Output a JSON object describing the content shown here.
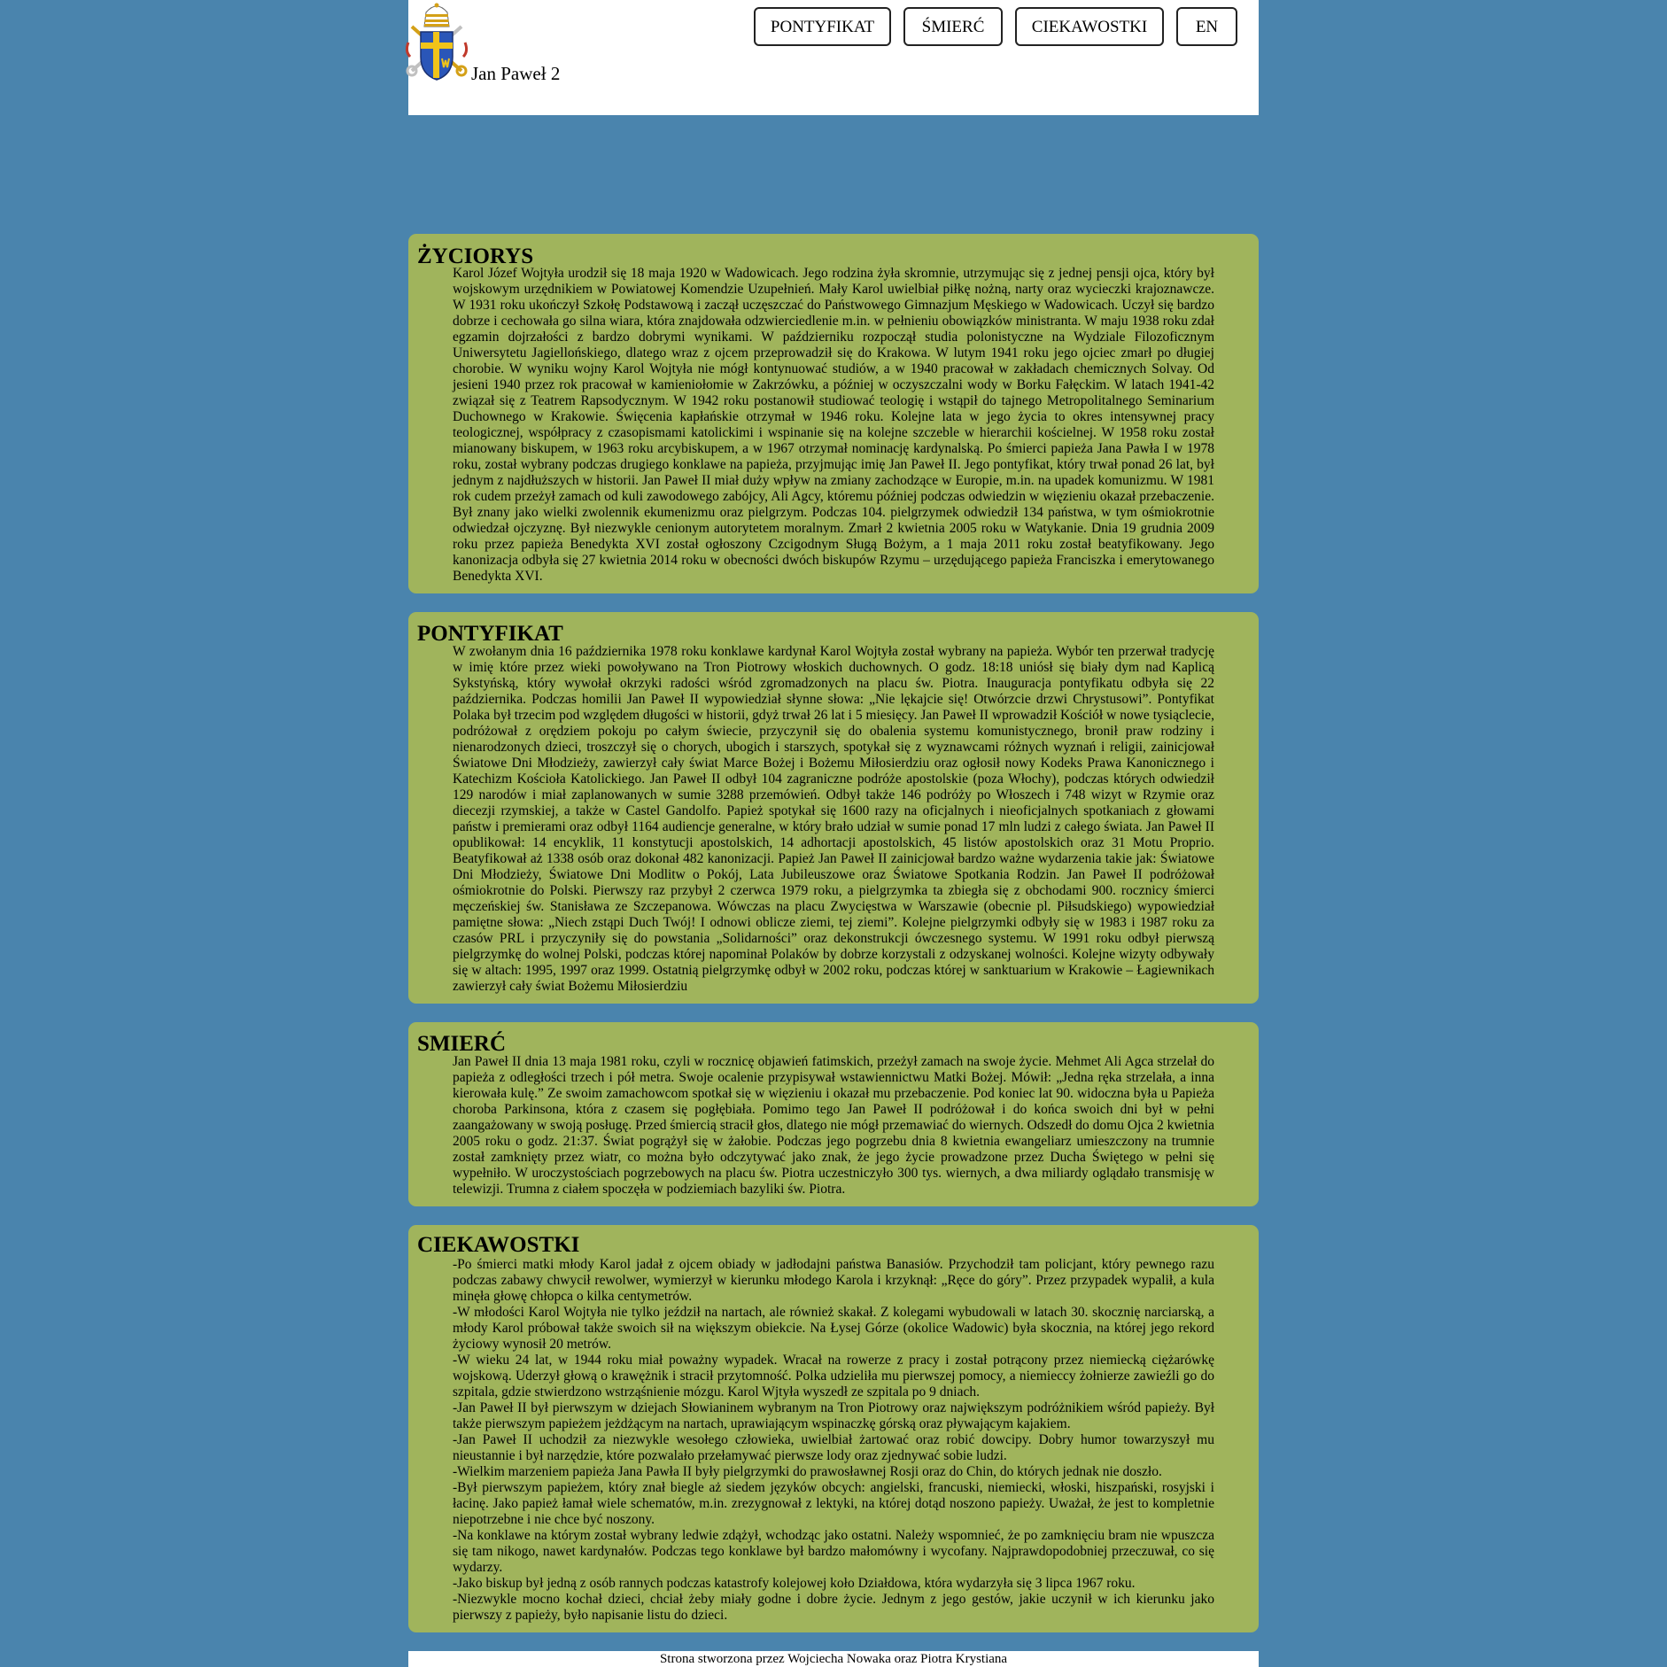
{
  "site": {
    "title": "Jan Paweł 2",
    "logo_icon": "papal-coat-of-arms-icon"
  },
  "nav": {
    "items": [
      "PONTYFIKAT",
      "ŚMIERĆ",
      "CIEKAWOSTKI",
      "EN"
    ]
  },
  "colors": {
    "background": "#4a84ad",
    "section": "#a0b45c",
    "header": "#ffffff"
  },
  "sections": [
    {
      "heading": "ŻYCIORYS",
      "paragraphs": [
        "Karol Józef Wojtyła urodził się 18 maja 1920 w Wadowicach. Jego rodzina żyła skromnie, utrzymując się z jednej pensji ojca, który był wojskowym urzędnikiem w Powiatowej Komendzie Uzupełnień. Mały Karol uwielbiał piłkę nożną, narty oraz wycieczki krajoznawcze. W 1931 roku ukończył Szkołę Podstawową i zaczął uczęszczać do Państwowego Gimnazjum Męskiego w Wadowicach. Uczył się bardzo dobrze i cechowała go silna wiara, która znajdowała odzwierciedlenie m.in. w pełnieniu obowiązków ministranta. W maju 1938 roku zdał egzamin dojrzałości z bardzo dobrymi wynikami. W październiku rozpoczął studia polonistyczne na Wydziale Filozoficznym Uniwersytetu Jagiellońskiego, dlatego wraz z ojcem przeprowadził się do Krakowa. W lutym 1941 roku jego ojciec zmarł po długiej chorobie. W wyniku wojny Karol Wojtyła nie mógł kontynuować studiów, a w 1940 pracował w zakładach chemicznych Solvay. Od jesieni 1940 przez rok pracował w kamieniołomie w Zakrzówku, a później w oczyszczalni wody w Borku Fałęckim. W latach 1941-42 związał się z Teatrem Rapsodycznym. W 1942 roku postanowił studiować teologię i wstąpił do tajnego Metropolitalnego Seminarium Duchownego w Krakowie. Święcenia kapłańskie otrzymał w 1946 roku. Kolejne lata w jego życia to okres intensywnej pracy teologicznej, współpracy z czasopismami katolickimi i wspinanie się na kolejne szczeble w hierarchii kościelnej. W 1958 roku został mianowany biskupem, w 1963 roku arcybiskupem, a w 1967 otrzymał nominację kardynalską. Po śmierci papieża Jana Pawła I w 1978 roku, został wybrany podczas drugiego konklawe na papieża, przyjmując imię Jan Paweł II. Jego pontyfikat, który trwał ponad 26 lat, był jednym z najdłuższych w historii. Jan Paweł II miał duży wpływ na zmiany zachodzące w Europie, m.in. na upadek komunizmu. W 1981 rok cudem przeżył zamach od kuli zawodowego zabójcy, Ali Agcy, któremu później podczas odwiedzin w więzieniu okazał przebaczenie. Był znany jako wielki zwolennik ekumenizmu oraz pielgrzym. Podczas 104. pielgrzymek odwiedził 134 państwa, w tym ośmiokrotnie odwiedzał ojczyznę. Był niezwykle cenionym autorytetem moralnym. Zmarł 2 kwietnia 2005 roku w Watykanie. Dnia 19 grudnia 2009 roku przez papieża Benedykta XVI został ogłoszony Czcigodnym Sługą Bożym, a 1 maja 2011 roku został beatyfikowany. Jego kanonizacja odbyła się 27 kwietnia 2014 roku w obecności dwóch biskupów Rzymu – urzędującego papieża Franciszka i emerytowanego Benedykta XVI."
      ]
    },
    {
      "heading": "PONTYFIKAT",
      "paragraphs": [
        "W zwołanym dnia 16 października 1978 roku konklawe kardynał Karol Wojtyła został wybrany na papieża. Wybór ten przerwał tradycję w imię które przez wieki powoływano na Tron Piotrowy włoskich duchownych. O godz. 18:18 uniósł się biały dym nad Kaplicą Sykstyńską, który wywołał okrzyki radości wśród zgromadzonych na placu św. Piotra. Inauguracja pontyfikatu odbyła się 22 października. Podczas homilii Jan Paweł II wypowiedział słynne słowa: „Nie lękajcie się! Otwórzcie drzwi Chrystusowi”. Pontyfikat Polaka był trzecim pod względem długości w historii, gdyż trwał 26 lat i 5 miesięcy. Jan Paweł II wprowadził Kościół w nowe tysiąclecie, podróżował z orędziem pokoju po całym świecie, przyczynił się do obalenia systemu komunistycznego, bronił praw rodziny i nienarodzonych dzieci, troszczył się o chorych, ubogich i starszych, spotykał się z wyznawcami różnych wyznań i religii, zainicjował Światowe Dni Młodzieży, zawierzył cały świat Marce Bożej i Bożemu Miłosierdziu oraz ogłosił nowy Kodeks Prawa Kanonicznego i Katechizm Kościoła Katolickiego. Jan Paweł II odbył 104 zagraniczne podróże apostolskie (poza Włochy), podczas których odwiedził 129 narodów i miał zaplanowanych w sumie 3288 przemówień. Odbył także 146 podróży po Włoszech i 748 wizyt w Rzymie oraz diecezji rzymskiej, a także w Castel Gandolfo. Papież spotykał się 1600 razy na oficjalnych i nieoficjalnych spotkaniach z głowami państw i premierami oraz odbył 1164 audiencje generalne, w który brało udział w sumie ponad 17 mln ludzi z całego świata. Jan Paweł II opublikował: 14 encyklik, 11 konstytucji apostolskich, 14 adhortacji apostolskich, 45 listów apostolskich oraz 31 Motu Proprio. Beatyfikował aż 1338 osób oraz dokonał 482 kanonizacji. Papież Jan Paweł II zainicjował bardzo ważne wydarzenia takie jak: Światowe Dni Młodzieży, Światowe Dni Modlitw o Pokój, Lata Jubileuszowe oraz Światowe Spotkania Rodzin. Jan Paweł II podróżował ośmiokrotnie do Polski. Pierwszy raz przybył 2 czerwca 1979 roku, a pielgrzymka ta zbiegła się z obchodami 900. rocznicy śmierci męczeńskiej św. Stanisława ze Szczepanowa. Wówczas na placu Zwycięstwa w Warszawie (obecnie pl. Piłsudskiego) wypowiedział pamiętne słowa: „Niech zstąpi Duch Twój! I odnowi oblicze ziemi, tej ziemi”. Kolejne pielgrzymki odbyły się w 1983 i 1987 roku za czasów PRL i przyczyniły się do powstania „Solidarności” oraz dekonstrukcji ówczesnego systemu. W 1991 roku odbył pierwszą pielgrzymkę do wolnej Polski, podczas której napominał Polaków by dobrze korzystali z odzyskanej wolności. Kolejne wizyty odbywały się w altach: 1995, 1997 oraz 1999. Ostatnią pielgrzymkę odbył w 2002 roku, podczas której w sanktuarium w Krakowie – Łagiewnikach zawierzył cały świat Bożemu Miłosierdziu"
      ]
    },
    {
      "heading": "SMIERĆ",
      "paragraphs": [
        "Jan Paweł II dnia 13 maja 1981 roku, czyli w rocznicę objawień fatimskich, przeżył zamach na swoje życie. Mehmet Ali Agca strzelał do papieża z odległości trzech i pół metra. Swoje ocalenie przypisywał wstawiennictwu Matki Bożej. Mówił: „Jedna ręka strzelała, a inna kierowała kulę.” Ze swoim zamachowcom spotkał się w więzieniu i okazał mu przebaczenie. Pod koniec lat 90. widoczna była u Papieża choroba Parkinsona, która z czasem się pogłębiała. Pomimo tego Jan Paweł II podróżował i do końca swoich dni był w pełni zaangażowany w swoją posługę. Przed śmiercią stracił głos, dlatego nie mógł przemawiać do wiernych. Odszedł do domu Ojca 2 kwietnia 2005 roku o godz. 21:37. Świat pogrążył się w żałobie. Podczas jego pogrzebu dnia 8 kwietnia ewangeliarz umieszczony na trumnie został zamknięty przez wiatr, co można było odczytywać jako znak, że jego życie prowadzone przez Ducha Świętego w pełni się wypełniło. W uroczystościach pogrzebowych na placu św. Piotra uczestniczyło 300 tys. wiernych, a dwa miliardy oglądało transmisję w telewizji. Trumna z ciałem spoczęła w podziemiach bazyliki św. Piotra."
      ]
    },
    {
      "heading": "CIEKAWOSTKI",
      "paragraphs": [
        "-Po śmierci matki młody Karol jadał z ojcem obiady w jadłodajni państwa Banasiów. Przychodził tam policjant, który pewnego razu podczas zabawy chwycił rewolwer, wymierzył w kierunku młodego Karola i krzyknął: „Ręce do góry”. Przez przypadek wypalił, a kula minęła głowę chłopca o kilka centymetrów.",
        "-W młodości Karol Wojtyła nie tylko jeździł na nartach, ale również skakał. Z kolegami wybudowali w latach 30. skocznię narciarską, a młody Karol próbował także swoich sił na większym obiekcie. Na Łysej Górze (okolice Wadowic) była skocznia, na której jego rekord życiowy wynosił 20 metrów.",
        "-W wieku 24 lat, w 1944 roku miał poważny wypadek. Wracał na rowerze z pracy i został potrącony przez niemiecką ciężarówkę wojskową. Uderzył głową o krawężnik i stracił przytomność. Polka udzieliła mu pierwszej pomocy, a niemieccy żołnierze zawieźli go do szpitala, gdzie stwierdzono wstrząśnienie mózgu. Karol Wjtyła wyszedł ze szpitala po 9 dniach.",
        "-Jan Paweł II był pierwszym w dziejach Słowianinem wybranym na Tron Piotrowy oraz największym podróżnikiem wśród papieży. Był także pierwszym papieżem jeżdżącym na nartach, uprawiającym wspinaczkę górską oraz pływającym kajakiem.",
        "-Jan Paweł II uchodził za niezwykle wesołego człowieka, uwielbiał żartować oraz robić dowcipy. Dobry humor towarzyszył mu nieustannie i był narzędzie, które pozwalało przełamywać pierwsze lody oraz zjednywać sobie ludzi.",
        "-Wielkim marzeniem papieża Jana Pawła II były pielgrzymki do prawosławnej Rosji oraz do Chin, do których jednak nie doszło.",
        "-Był pierwszym papieżem, który znał biegle aż siedem języków obcych: angielski, francuski, niemiecki, włoski, hiszpański, rosyjski i łacinę. Jako papież łamał wiele schematów, m.in. zrezygnował z lektyki, na której dotąd noszono papieży. Uważał, że jest to kompletnie niepotrzebne i nie chce być noszony.",
        "-Na konklawe na którym został wybrany ledwie zdążył, wchodząc jako ostatni. Należy wspomnieć, że po zamknięciu bram nie wpuszcza się tam nikogo, nawet kardynałów. Podczas tego konklawe był bardzo małomówny i wycofany. Najprawdopodobniej przeczuwał, co się wydarzy.",
        "-Jako biskup był jedną z osób rannych podczas katastrofy kolejowej koło Działdowa, która wydarzyła się 3 lipca 1967 roku.",
        "-Niezwykle mocno kochał dzieci, chciał żeby miały godne i dobre życie. Jednym z jego gestów, jakie uczynił w ich kierunku jako pierwszy z papieży, było napisanie listu do dzieci."
      ]
    }
  ],
  "footer": {
    "text": "Strona stworzona przez Wojciecha Nowaka oraz Piotra Krystiana"
  }
}
